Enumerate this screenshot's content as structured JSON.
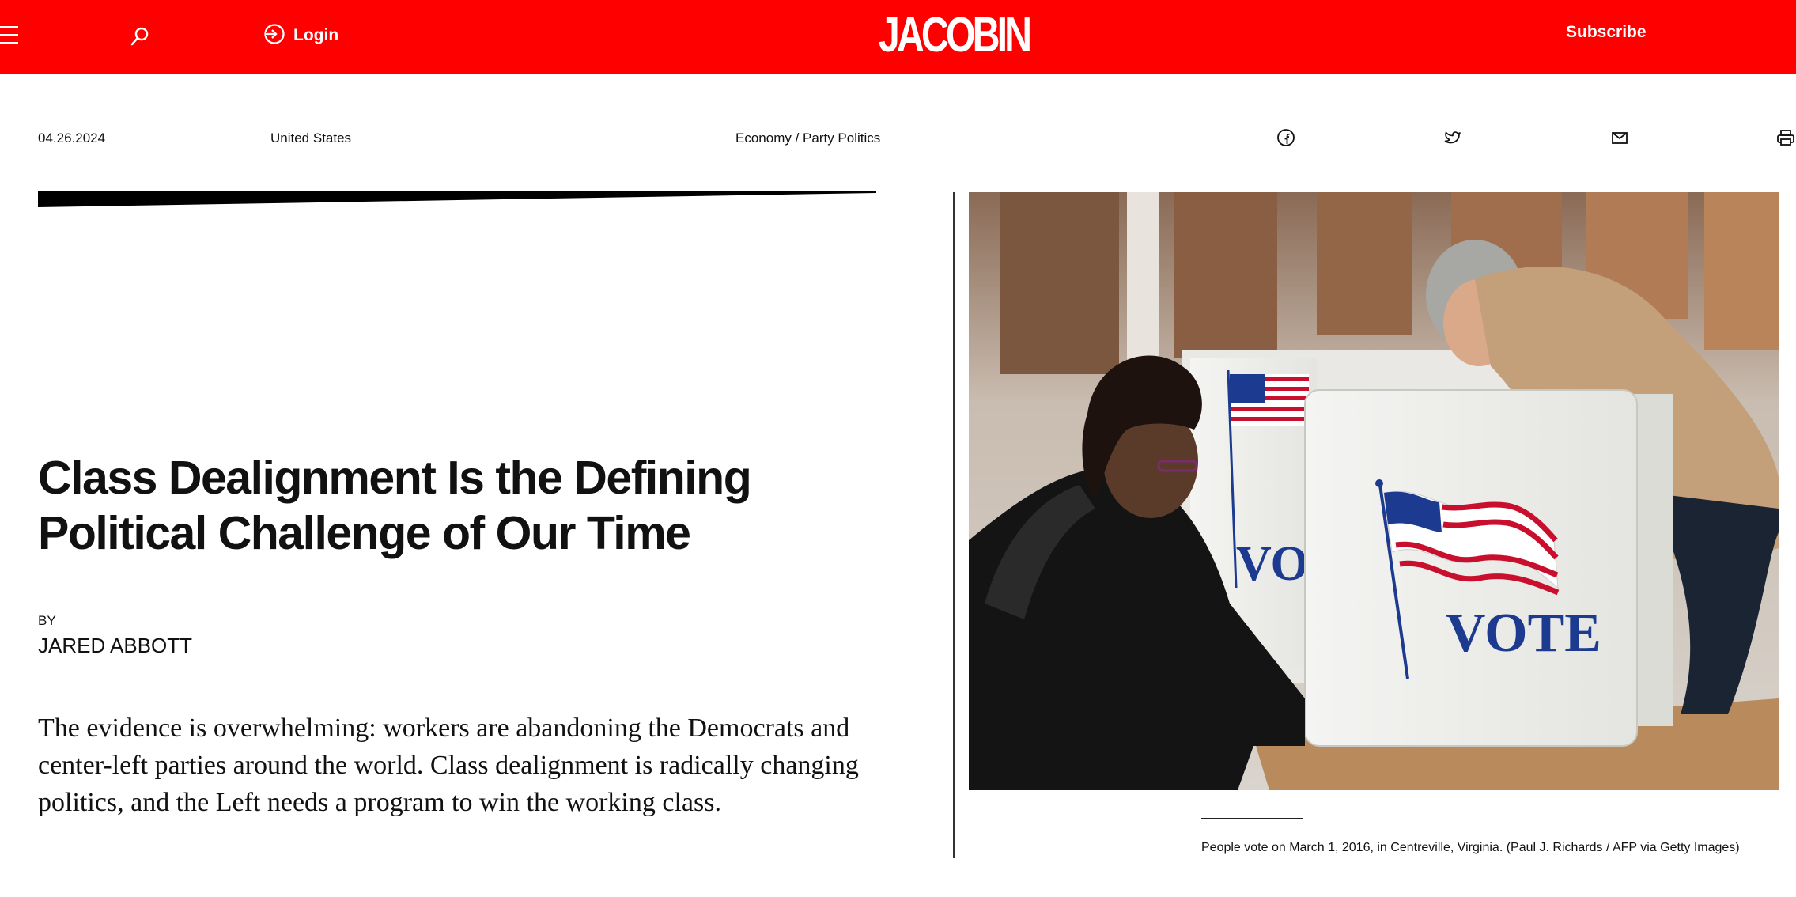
{
  "header": {
    "login_label": "Login",
    "logo_text": "JACOBIN",
    "subscribe_label": "Subscribe",
    "icons": [
      "menu-icon",
      "search-icon",
      "login-icon"
    ],
    "brand_color": "#ff0000"
  },
  "article": {
    "date": "04.26.2024",
    "region": "United States",
    "topics": "Economy / Party Politics",
    "share_icons": [
      "facebook-icon",
      "twitter-icon",
      "email-icon",
      "print-icon"
    ],
    "title": "Class Dealignment Is the Defining Political Challenge of Our Time",
    "byline_label": "BY",
    "author": "JARED ABBOTT",
    "dek": "The evidence is overwhelming: workers are abandoning the Democrats and center-left parties around the world. Class dealignment is radically changing politics, and the Left needs a program to win the working class."
  },
  "hero_image": {
    "booth_text_left": "VO",
    "booth_text_right": "VOTE",
    "caption": "People vote on March 1, 2016, in Centreville, Virginia. (Paul J. Richards / AFP via Getty Images)"
  }
}
